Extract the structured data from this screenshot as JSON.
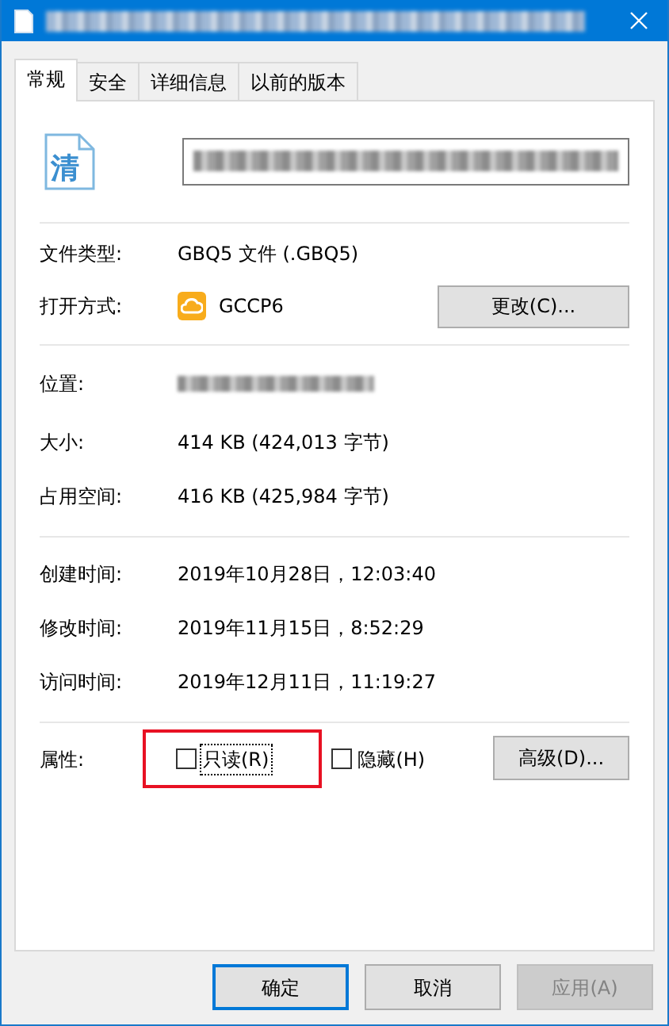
{
  "window": {
    "kind": "redacted"
  },
  "tabs": [
    {
      "label": "常规",
      "selected": true
    },
    {
      "label": "安全",
      "selected": false
    },
    {
      "label": "详细信息",
      "selected": false
    },
    {
      "label": "以前的版本",
      "selected": false
    }
  ],
  "file_icon_glyph": "清",
  "type_row": {
    "label": "文件类型:",
    "value": "GBQ5 文件 (.GBQ5)"
  },
  "opens_with": {
    "label": "打开方式:",
    "app": "GCCP6",
    "button": "更改(C)..."
  },
  "location": {
    "label": "位置:"
  },
  "size_rows": [
    {
      "label": "大小:",
      "value": "414 KB (424,013 字节)"
    },
    {
      "label": "占用空间:",
      "value": "416 KB (425,984 字节)"
    }
  ],
  "time_rows": [
    {
      "label": "创建时间:",
      "value": "2019年10月28日，12:03:40"
    },
    {
      "label": "修改时间:",
      "value": "2019年11月15日，8:52:29"
    },
    {
      "label": "访问时间:",
      "value": "2019年12月11日，11:19:27"
    }
  ],
  "attributes": {
    "label": "属性:",
    "options": [
      {
        "label": "只读(R)",
        "checked": false,
        "focused": true,
        "highlighted": true
      },
      {
        "label": "隐藏(H)",
        "checked": false,
        "focused": false,
        "highlighted": false
      }
    ],
    "button": "高级(D)..."
  },
  "buttons": [
    {
      "label": "确定",
      "is_default": true,
      "disabled": false
    },
    {
      "label": "取消",
      "is_default": false,
      "disabled": false
    },
    {
      "label": "应用(A)",
      "is_default": false,
      "disabled": true
    }
  ]
}
